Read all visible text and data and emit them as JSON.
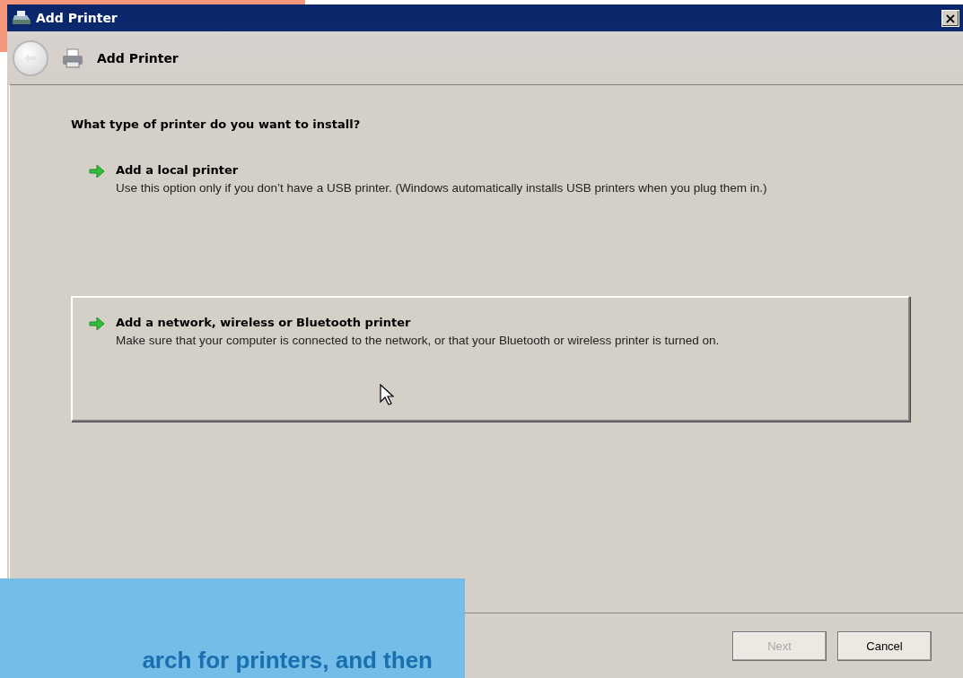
{
  "window": {
    "title": "Add Printer",
    "close_label": "×"
  },
  "header": {
    "title": "Add Printer"
  },
  "question": "What type of printer do you want to install?",
  "options": [
    {
      "title": "Add a local printer",
      "description": "Use this option only if you don’t have a USB printer. (Windows automatically installs USB printers when you plug them in.)",
      "highlighted": false
    },
    {
      "title": "Add a network, wireless or Bluetooth printer",
      "description": "Make sure that your computer is connected to the network, or that your Bluetooth or wireless printer is turned on.",
      "highlighted": true
    }
  ],
  "buttons": [
    {
      "label": "Next",
      "disabled": true
    },
    {
      "label": "Cancel",
      "disabled": false
    }
  ],
  "callout": {
    "text": "arch for printers, and then"
  }
}
